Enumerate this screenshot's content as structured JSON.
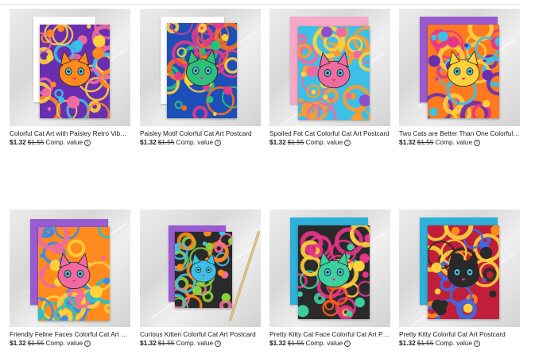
{
  "products": [
    {
      "title": "Colorful Cat Art with Paisley Retro Vibe P...",
      "price": "$1.32",
      "was": "$1.55",
      "comp": "Comp. value",
      "back_color": "#ffffff",
      "palette": [
        "#6a2fb0",
        "#f06aa0",
        "#ff8a1e",
        "#ffd23c",
        "#3cc0e8"
      ]
    },
    {
      "title": "Paisley Motif Colorful Cat Art Postcard",
      "price": "$1.32",
      "was": "$1.55",
      "comp": "Comp. value",
      "back_color": "#ffffff",
      "palette": [
        "#1c4fb8",
        "#ff6a1e",
        "#2ec07a",
        "#ffd23c",
        "#e63a8a"
      ]
    },
    {
      "title": "Spoiled Fat Cat Colorful Cat Art Postcard",
      "price": "$1.32",
      "was": "$1.55",
      "comp": "Comp. value",
      "back_color": "#f5a8c8",
      "palette": [
        "#3cc0e8",
        "#ff9a2e",
        "#f06aa0",
        "#ffd23c",
        "#8a4fd0"
      ]
    },
    {
      "title": "Two Cats are Better Than One Colorful C...",
      "price": "$1.32",
      "was": "$1.55",
      "comp": "Comp. value",
      "back_color": "#9a5ad0",
      "palette": [
        "#ff7a1e",
        "#e6348a",
        "#ffd23c",
        "#6a2fb0",
        "#3cc0e8"
      ]
    },
    {
      "title": "Friendly Feline Faces Colorful Cat Art Pos...",
      "price": "$1.32",
      "was": "$1.55",
      "comp": "Comp. value",
      "back_color": "#9a5ad0",
      "palette": [
        "#ff8a1e",
        "#3c8ae8",
        "#f06aa0",
        "#ffd23c",
        "#2ec0c0"
      ]
    },
    {
      "title": "Curious Kitten Colorful Cat Art Postcard",
      "price": "$1.32",
      "was": "$1.55",
      "comp": "Comp. value",
      "back_color": "#9a5ad0",
      "palette": [
        "#2a2a2a",
        "#ff8a1e",
        "#3cc0e8",
        "#f06aa0",
        "#8ad23c"
      ]
    },
    {
      "title": "Pretty Kitty Cat Face Colorful Cat Art Post...",
      "price": "$1.32",
      "was": "$1.55",
      "comp": "Comp. value",
      "back_color": "#2eb0d8",
      "palette": [
        "#2a2a2a",
        "#ff5a1e",
        "#3cd0a0",
        "#ffd23c",
        "#e6348a"
      ]
    },
    {
      "title": "Pretty Kitty Colorful Cat  Art Postcard",
      "price": "$1.32",
      "was": "$1.55",
      "comp": "Comp. value",
      "back_color": "#2eb0d8",
      "palette": [
        "#c01e3a",
        "#ff8a1e",
        "#2a2a2a",
        "#3c6ae8",
        "#ffd23c"
      ]
    }
  ]
}
